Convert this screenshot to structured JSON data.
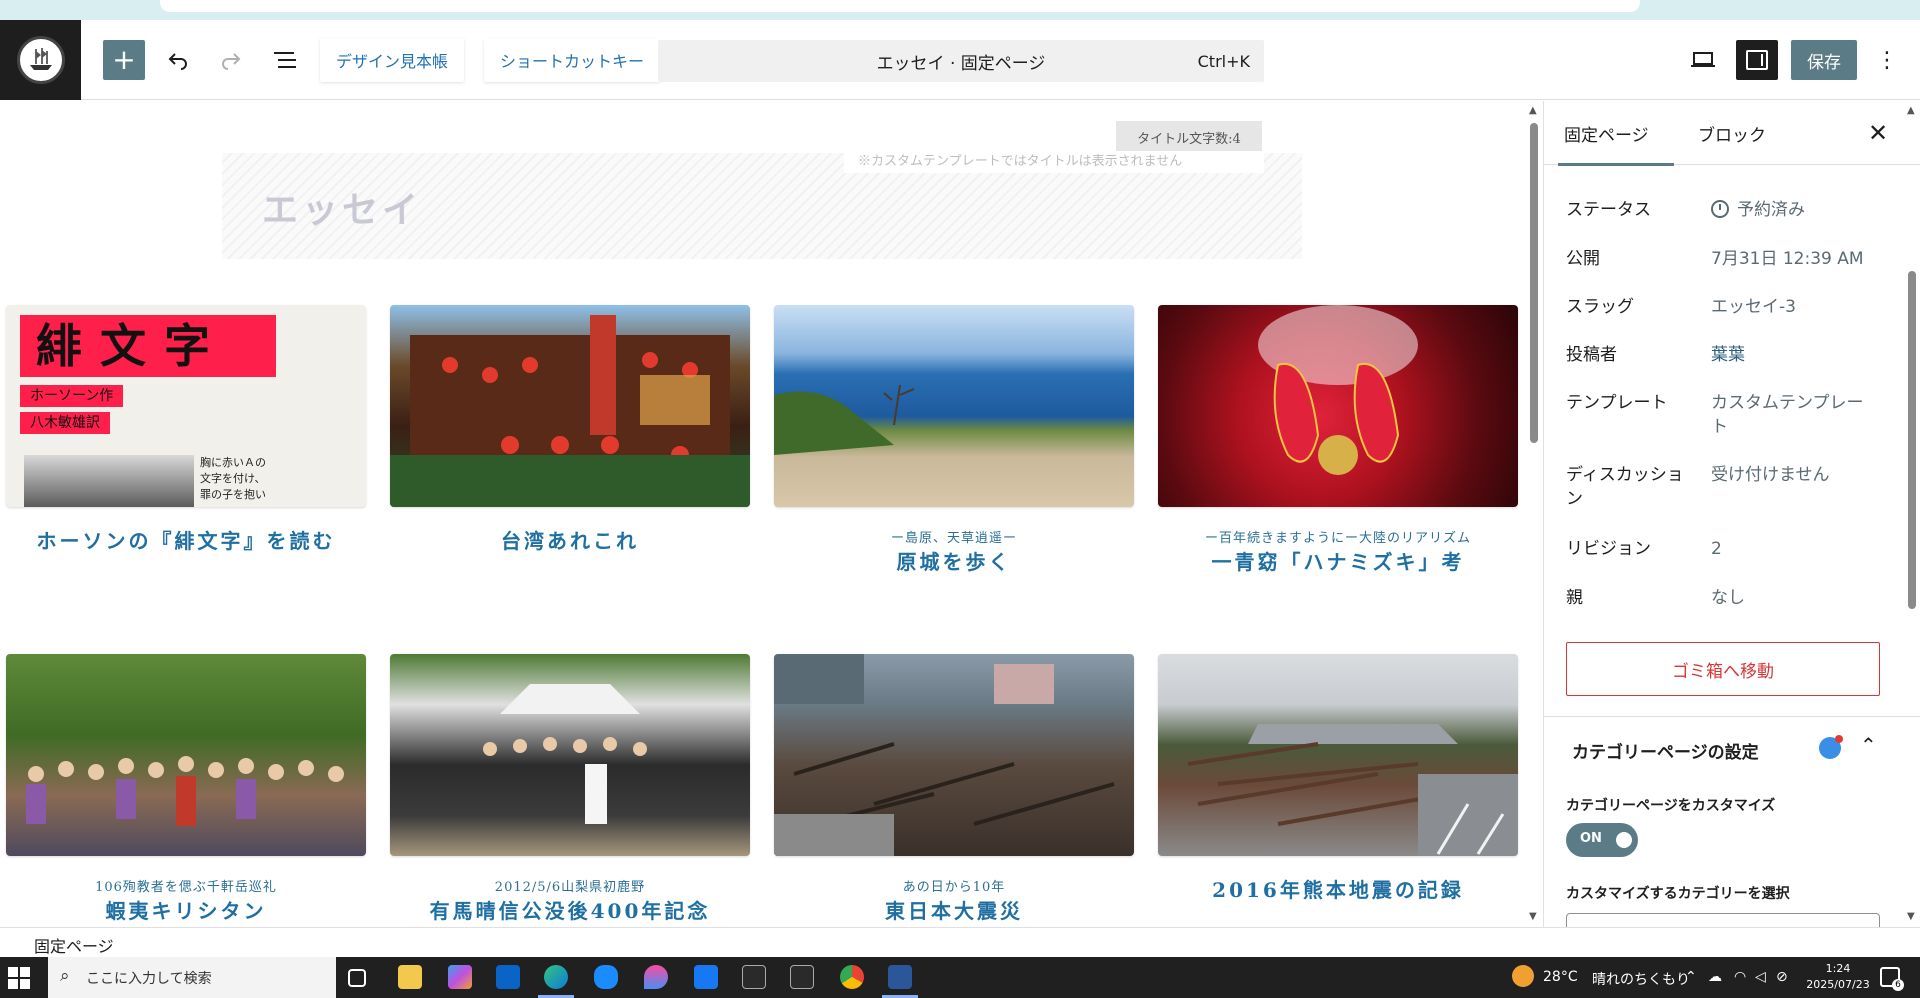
{
  "header": {
    "design_link": "デザイン見本帳",
    "shortcut_link": "ショートカットキー",
    "command_title": "エッセイ · 固定ページ",
    "command_shortcut": "Ctrl+K",
    "save_label": "保存"
  },
  "canvas": {
    "title_counter": "タイトル文字数:4",
    "template_note": "※カスタムテンプレートではタイトルは表示されません",
    "page_title": "エッセイ",
    "cards": [
      {
        "subtitle": "",
        "title": "ホーソンの『緋文字』を読む",
        "thumb": "scarlet-letter-book"
      },
      {
        "subtitle": "",
        "title": "台湾あれこれ",
        "thumb": "taiwan-teahouse"
      },
      {
        "subtitle": "ー島原、天草逍遥ー",
        "title": "原城を歩く",
        "thumb": "seaside-cliff"
      },
      {
        "subtitle": "ー百年続きますようにー大陸のリアリズム",
        "title": "一青窈「ハナミズキ」考",
        "thumb": "red-shoes"
      },
      {
        "subtitle": "106殉教者を偲ぶ千軒岳巡礼",
        "title": "蝦夷キリシタン",
        "thumb": "pilgrim-group"
      },
      {
        "subtitle": "2012/5/6山梨県初鹿野",
        "title": "有馬晴信公没後400年記念",
        "thumb": "memorial-group"
      },
      {
        "subtitle": "あの日から10年",
        "title": "東日本大震災",
        "thumb": "tsunami-rubble"
      },
      {
        "subtitle": "",
        "title": "2016年熊本地震の記録",
        "thumb": "collapsed-house"
      }
    ],
    "book_cover": {
      "big_text": "緋文字",
      "author": "ホーソーン作",
      "translator": "八木敏雄訳",
      "blurb_lines": [
        "胸に赤いＡの",
        "文字を付け、",
        "罪の子を抱い"
      ]
    }
  },
  "sidebar": {
    "tab_page": "固定ページ",
    "tab_block": "ブロック",
    "rows": [
      {
        "key": "ステータス",
        "value": "予約済み"
      },
      {
        "key": "公開",
        "value": "7月31日 12:39 AM"
      },
      {
        "key": "スラッグ",
        "value": "エッセイ-3"
      },
      {
        "key": "投稿者",
        "value": "葉葉"
      },
      {
        "key": "テンプレート",
        "value": "カスタムテンプレート"
      },
      {
        "key": "ディスカッション",
        "value": "受け付けません"
      },
      {
        "key": "リビジョン",
        "value": "2"
      },
      {
        "key": "親",
        "value": "なし"
      }
    ],
    "trash_label": "ゴミ箱へ移動",
    "category_panel": {
      "heading": "カテゴリーページの設定",
      "customize_label": "カテゴリーページをカスタマイズ",
      "toggle_state": "ON",
      "select_label": "カスタマイズするカテゴリーを選択"
    }
  },
  "footer": {
    "breadcrumb": "固定ページ"
  },
  "taskbar": {
    "search_placeholder": "ここに入力して検索",
    "weather_temp": "28°C",
    "weather_text": "晴れのちくもり",
    "time": "1:24",
    "date": "2025/07/23",
    "notification_count": "6"
  },
  "colors": {
    "accent": "#5b7c86",
    "link": "#2271b1",
    "card_title": "#1f6fa2",
    "danger": "#d63638",
    "header_dark": "#1e1e1e"
  }
}
